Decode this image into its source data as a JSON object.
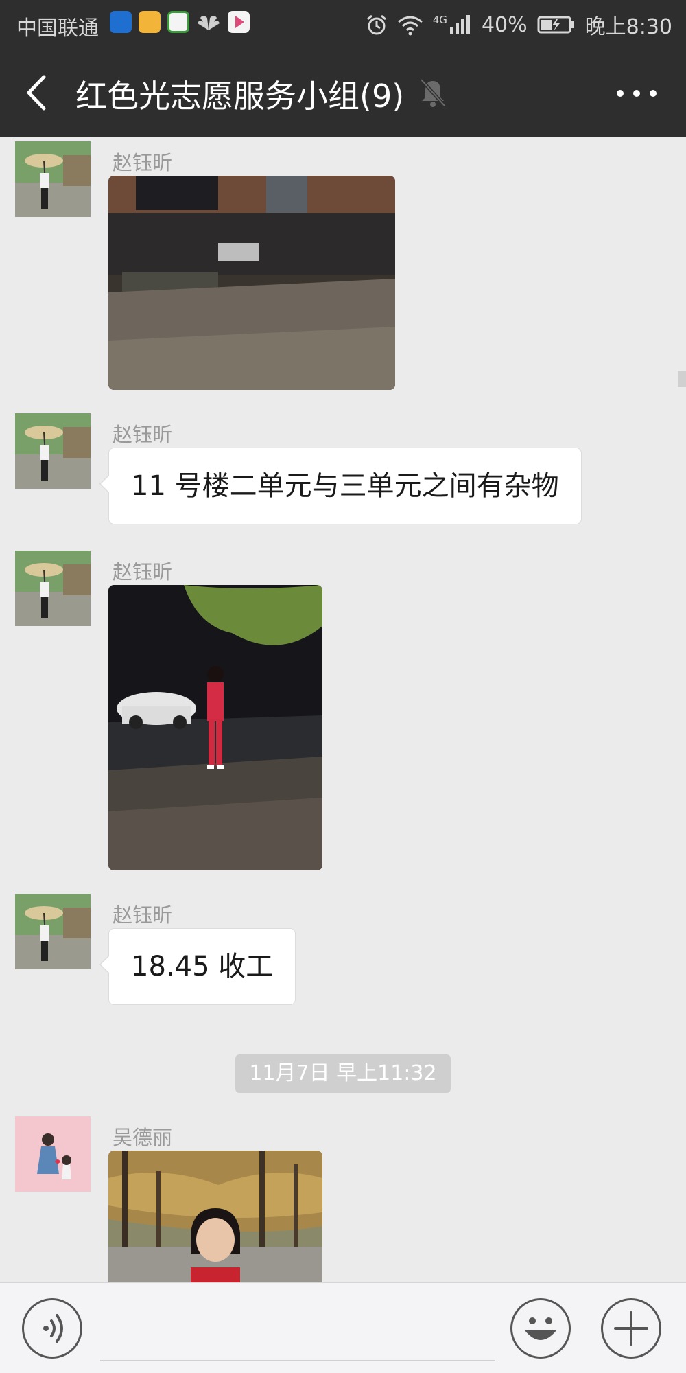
{
  "status_bar": {
    "carrier": "中国联通",
    "battery": "40%",
    "time": "晚上8:30",
    "network": "4G",
    "icons": [
      "shield-app-icon",
      "qu-app-icon",
      "browser-app-icon",
      "huawei-app-icon",
      "video-app-icon",
      "alarm-icon",
      "wifi-icon",
      "signal-icon",
      "battery-icon"
    ]
  },
  "header": {
    "back_icon": "chevron-left-icon",
    "title": "红色光志愿服务小组(9)",
    "mute_icon": "bell-muted-icon",
    "more_icon": "more-dots-icon"
  },
  "messages": [
    {
      "sender": "赵钰昕",
      "type": "image",
      "content": "photo: building corner at night"
    },
    {
      "sender": "赵钰昕",
      "type": "text",
      "text": "11 号楼二单元与三单元之间有杂物"
    },
    {
      "sender": "赵钰昕",
      "type": "image",
      "content": "photo: girl in red tracksuit at night"
    },
    {
      "sender": "赵钰昕",
      "type": "text",
      "text": "18.45 收工"
    },
    {
      "sender": "吴德丽",
      "type": "image",
      "content": "photo: girl in front of autumn trees"
    }
  ],
  "timestamp": "11月7日 早上11:32",
  "input_bar": {
    "voice_icon": "voice-icon",
    "emoji_icon": "smiley-icon",
    "plus_icon": "plus-icon"
  },
  "colors": {
    "header_bg": "#2e2e2e",
    "chat_bg": "#ebebeb",
    "bubble_bg": "#ffffff",
    "timestamp_bg": "#cfcfcf"
  }
}
